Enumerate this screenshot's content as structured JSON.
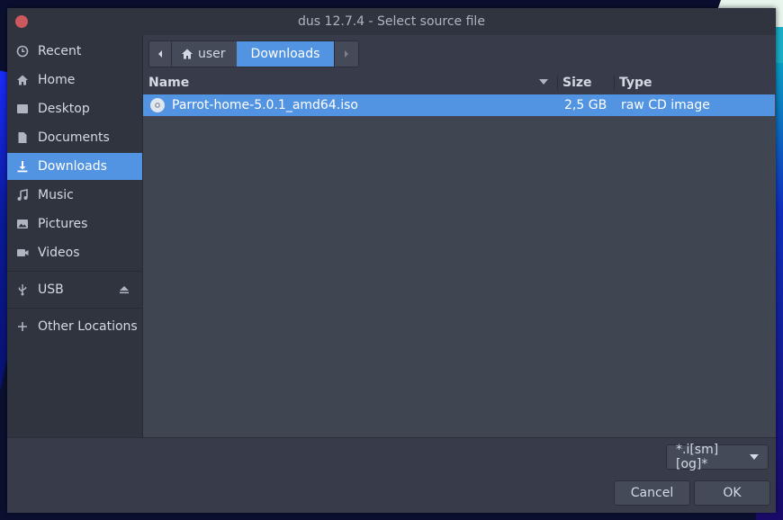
{
  "window": {
    "title": "dus 12.7.4 - Select source file"
  },
  "sidebar": {
    "items": [
      {
        "label": "Recent",
        "icon": "clock-icon"
      },
      {
        "label": "Home",
        "icon": "home-icon"
      },
      {
        "label": "Desktop",
        "icon": "desktop-icon"
      },
      {
        "label": "Documents",
        "icon": "document-icon"
      },
      {
        "label": "Downloads",
        "icon": "download-icon",
        "active": true
      },
      {
        "label": "Music",
        "icon": "music-icon"
      },
      {
        "label": "Pictures",
        "icon": "picture-icon"
      },
      {
        "label": "Videos",
        "icon": "video-icon"
      },
      {
        "label": "USB",
        "icon": "usb-icon"
      },
      {
        "label": "Other Locations",
        "icon": "plus-icon"
      }
    ]
  },
  "pathbar": {
    "items": [
      "user",
      "Downloads"
    ]
  },
  "filelist": {
    "columns": [
      "Name",
      "Size",
      "Type"
    ],
    "rows": [
      {
        "name": "Parrot-home-5.0.1_amd64.iso",
        "size": "2,5 GB",
        "type": "raw CD image",
        "selected": true
      }
    ]
  },
  "filter": {
    "value": "*.i[sm][og]*"
  },
  "buttons": {
    "cancel": "Cancel",
    "ok": "OK"
  },
  "colors": {
    "accent": "#5294e2",
    "close": "#cc575d",
    "background": "#383c4a"
  }
}
